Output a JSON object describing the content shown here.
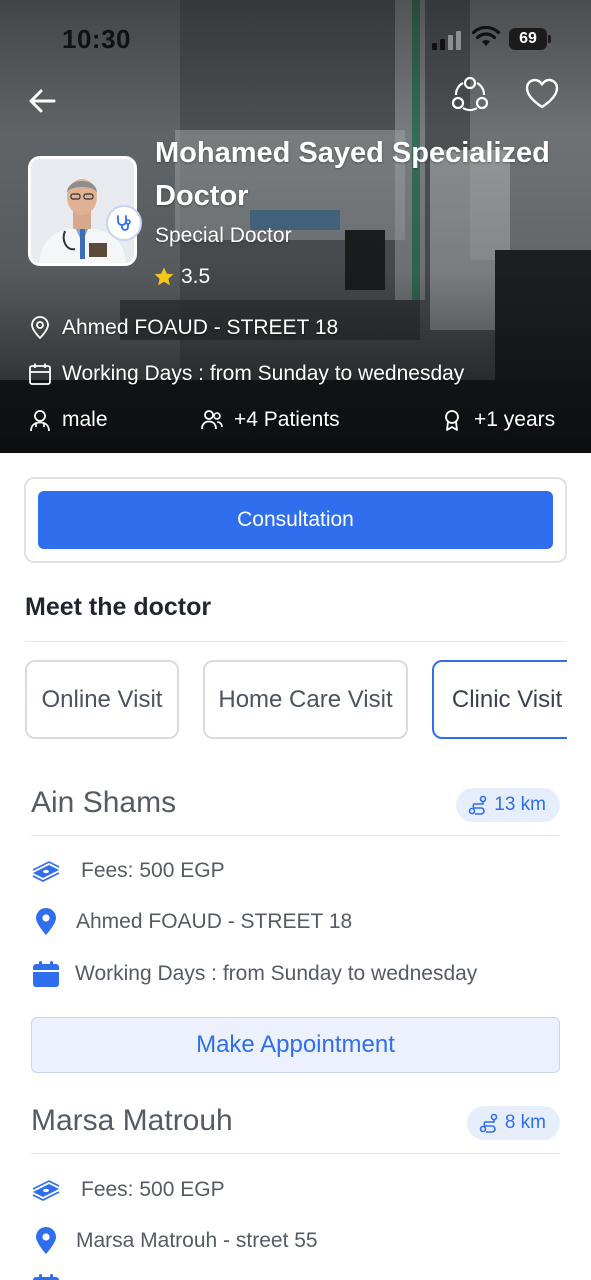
{
  "status_bar": {
    "time": "10:30",
    "battery": "69"
  },
  "doctor": {
    "name": "Mohamed Sayed Specialized Doctor",
    "title": "Special Doctor",
    "rating": "3.5",
    "address": "Ahmed FOAUD - STREET 18",
    "working_days": "Working Days : from Sunday to wednesday",
    "gender": "male",
    "patients": "+4 Patients",
    "experience": "+1 years"
  },
  "consultation_label": "Consultation",
  "meet_title": "Meet the doctor",
  "visit_tabs": [
    {
      "label": "Online Visit"
    },
    {
      "label": "Home Care Visit"
    },
    {
      "label": "Clinic Visit"
    }
  ],
  "branches": [
    {
      "name": "Ain Shams",
      "distance": "13 km",
      "fees": "Fees: 500 EGP",
      "address": "Ahmed FOAUD - STREET 18",
      "working_days": "Working Days : from Sunday to wednesday",
      "appointment_label": "Make Appointment"
    },
    {
      "name": "Marsa Matrouh",
      "distance": "8 km",
      "fees": "Fees: 500 EGP",
      "address": "Marsa Matrouh - street 55"
    }
  ],
  "colors": {
    "primary": "#2f6fee",
    "pill_bg": "#e6eefc",
    "appt_bg": "#edf1fd"
  }
}
